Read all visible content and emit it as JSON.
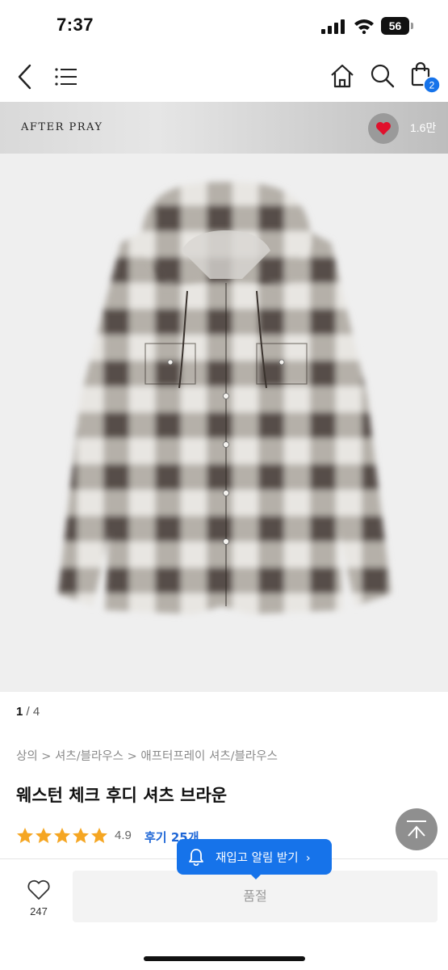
{
  "status_bar": {
    "time": "7:37",
    "battery": "56"
  },
  "nav": {
    "back_icon": "chevron-left-icon",
    "menu_icon": "hamburger-menu-icon",
    "home_icon": "home-icon",
    "search_icon": "search-icon",
    "cart_icon": "shopping-bag-icon",
    "cart_badge": "2"
  },
  "brand": {
    "name": "AFTER PRAY",
    "likes": "1.6만",
    "heart_color": "#e0102c"
  },
  "gallery": {
    "current": "1",
    "separator": " / ",
    "total": "4"
  },
  "product": {
    "breadcrumb": "상의 > 셔츠/블라우스 > 애프터프레이 셔츠/블라우스",
    "title": "웨스턴 체크 후디 셔츠 브라운",
    "rating": "4.9",
    "stars": 5,
    "reviews": "후기 25개"
  },
  "restock": {
    "label": "재입고 알림 받기",
    "arrow": "›",
    "color": "#1673ea"
  },
  "bottom": {
    "wish_count": "247",
    "soldout_label": "품절"
  }
}
